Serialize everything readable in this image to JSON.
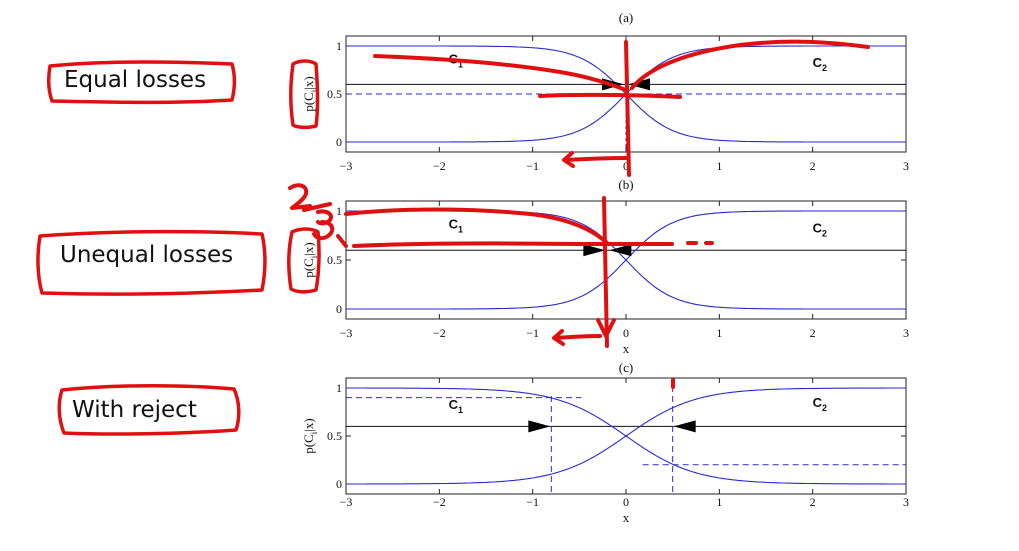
{
  "annotations": {
    "equal_losses": "Equal losses",
    "unequal_losses": "Unequal losses",
    "with_reject": "With reject",
    "handwritten_fraction": "2/3"
  },
  "colors": {
    "curve": "#2a2ad4",
    "threshold": "#111111",
    "ink": "#e01010"
  },
  "chart_data": [
    {
      "type": "line",
      "title": "(a)",
      "xlabel": "",
      "ylabel": "p(C_i|x)",
      "xlim": [
        -3,
        3
      ],
      "ylim": [
        0,
        1
      ],
      "x_ticks": [
        "-3",
        "-2",
        "-1",
        "0",
        "1",
        "2",
        "3"
      ],
      "y_ticks": [
        "0",
        "0.5",
        "1"
      ],
      "class_labels": [
        {
          "name": "C",
          "sub": "1",
          "x": -1.9,
          "y": 0.82
        },
        {
          "name": "C",
          "sub": "2",
          "x": 2.0,
          "y": 0.78
        }
      ],
      "series": [
        {
          "name": "p(C1|x)",
          "curve": "logistic_decreasing",
          "steepness": 4,
          "x": [
            -3,
            -2,
            -1,
            -0.5,
            0,
            0.5,
            1,
            2,
            3
          ],
          "values": [
            1.0,
            1.0,
            0.98,
            0.88,
            0.5,
            0.12,
            0.02,
            0.0,
            0.0
          ]
        },
        {
          "name": "p(C2|x)",
          "curve": "logistic_increasing",
          "steepness": 4,
          "x": [
            -3,
            -2,
            -1,
            -0.5,
            0,
            0.5,
            1,
            2,
            3
          ],
          "values": [
            0.0,
            0.0,
            0.02,
            0.12,
            0.5,
            0.88,
            0.98,
            1.0,
            1.0
          ]
        }
      ],
      "threshold_solid": 0.6,
      "threshold_dashed": 0.5,
      "decision_x": 0
    },
    {
      "type": "line",
      "title": "(b)",
      "xlabel": "x",
      "ylabel": "p(C_i|x)",
      "xlim": [
        -3,
        3
      ],
      "ylim": [
        0,
        1
      ],
      "x_ticks": [
        "-3",
        "-2",
        "-1",
        "0",
        "1",
        "2",
        "3"
      ],
      "y_ticks": [
        "0",
        "0.5",
        "1"
      ],
      "class_labels": [
        {
          "name": "C",
          "sub": "1",
          "x": -1.9,
          "y": 0.82
        },
        {
          "name": "C",
          "sub": "2",
          "x": 2.0,
          "y": 0.78
        }
      ],
      "series": [
        {
          "name": "p(C1|x)",
          "curve": "logistic_decreasing",
          "steepness": 4,
          "x": [
            -3,
            -2,
            -1,
            -0.5,
            0,
            0.5,
            1,
            2,
            3
          ],
          "values": [
            1.0,
            1.0,
            0.98,
            0.88,
            0.5,
            0.12,
            0.02,
            0.0,
            0.0
          ]
        },
        {
          "name": "p(C2|x)",
          "curve": "logistic_increasing",
          "steepness": 4,
          "x": [
            -3,
            -2,
            -1,
            -0.5,
            0,
            0.5,
            1,
            2,
            3
          ],
          "values": [
            0.0,
            0.0,
            0.02,
            0.12,
            0.5,
            0.88,
            0.98,
            1.0,
            1.0
          ]
        }
      ],
      "threshold_solid": 0.6,
      "decision_x": -0.2
    },
    {
      "type": "line",
      "title": "(c)",
      "xlabel": "x",
      "ylabel": "p(C_i|x)",
      "xlim": [
        -3,
        3
      ],
      "ylim": [
        0,
        1
      ],
      "x_ticks": [
        "-3",
        "-2",
        "-1",
        "0",
        "1",
        "2",
        "3"
      ],
      "y_ticks": [
        "0",
        "0.5",
        "1"
      ],
      "class_labels": [
        {
          "name": "C",
          "sub": "1",
          "x": -1.9,
          "y": 0.78
        },
        {
          "name": "C",
          "sub": "2",
          "x": 2.0,
          "y": 0.8
        }
      ],
      "series": [
        {
          "name": "p(C1|x)",
          "curve": "logistic_decreasing",
          "steepness": 2.7,
          "x": [
            -3,
            -2,
            -1,
            -0.5,
            0,
            0.5,
            1,
            2,
            3
          ],
          "values": [
            1.0,
            0.99,
            0.94,
            0.79,
            0.5,
            0.21,
            0.06,
            0.01,
            0.0
          ]
        },
        {
          "name": "p(C2|x)",
          "curve": "logistic_increasing",
          "steepness": 2.7,
          "x": [
            -3,
            -2,
            -1,
            -0.5,
            0,
            0.5,
            1,
            2,
            3
          ],
          "values": [
            0.0,
            0.01,
            0.06,
            0.21,
            0.5,
            0.79,
            0.94,
            0.99,
            1.0
          ]
        }
      ],
      "threshold_solid": 0.6,
      "reject_threshold_upper": 0.9,
      "reject_threshold_lower": 0.2,
      "reject_x_left": -0.8,
      "reject_x_right": 0.5
    }
  ]
}
